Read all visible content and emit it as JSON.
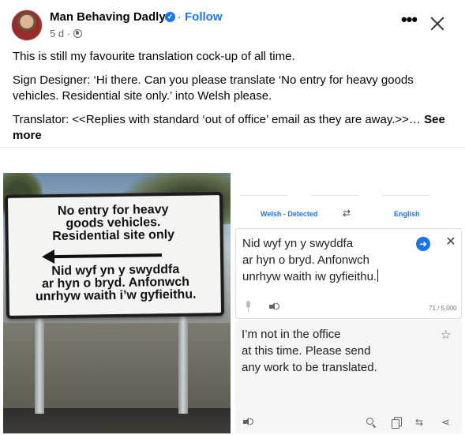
{
  "post": {
    "author": "Man Behaving Dadly",
    "verified_mark": "✓",
    "separator": "·",
    "follow_label": "Follow",
    "time": "5 d ·",
    "paragraphs": [
      "This is still my favourite translation cock-up of all time.",
      "Sign Designer: ‘Hi there. Can you please translate ‘No entry for heavy goods vehicles. Residential site only.’ into Welsh please.",
      "Translator: <<Replies with standard ‘out of office’ email as they are away.>>…"
    ],
    "see_more_label": "See more",
    "more_icon_glyph": "•••"
  },
  "sign": {
    "english_lines": [
      "No entry for heavy",
      "goods vehicles.",
      "Residential site only"
    ],
    "welsh_lines": [
      "Nid wyf yn y swyddfa",
      "ar hyn o bryd. Anfonwch",
      "unrhyw waith i’w gyfieithu."
    ]
  },
  "translate": {
    "source_lang": "Welsh - Detected",
    "target_lang": "English",
    "swap_glyph": "⇄",
    "source_lines": [
      "Nid wyf yn y swyddfa",
      "ar hyn o bryd. Anfonwch",
      "unrhyw waith iw gyfieithu."
    ],
    "char_count": "71 / 5,000",
    "target_lines": [
      "I’m not in the office",
      "at this time. Please send",
      "any work to be translated."
    ],
    "go_glyph": "➜",
    "clear_glyph": "✕",
    "star_glyph": "☆",
    "feedback_glyph": "⇆",
    "share_glyph": "⋖"
  },
  "colors": {
    "accent": "#1877f2",
    "translate_blue": "#1a73e8"
  }
}
